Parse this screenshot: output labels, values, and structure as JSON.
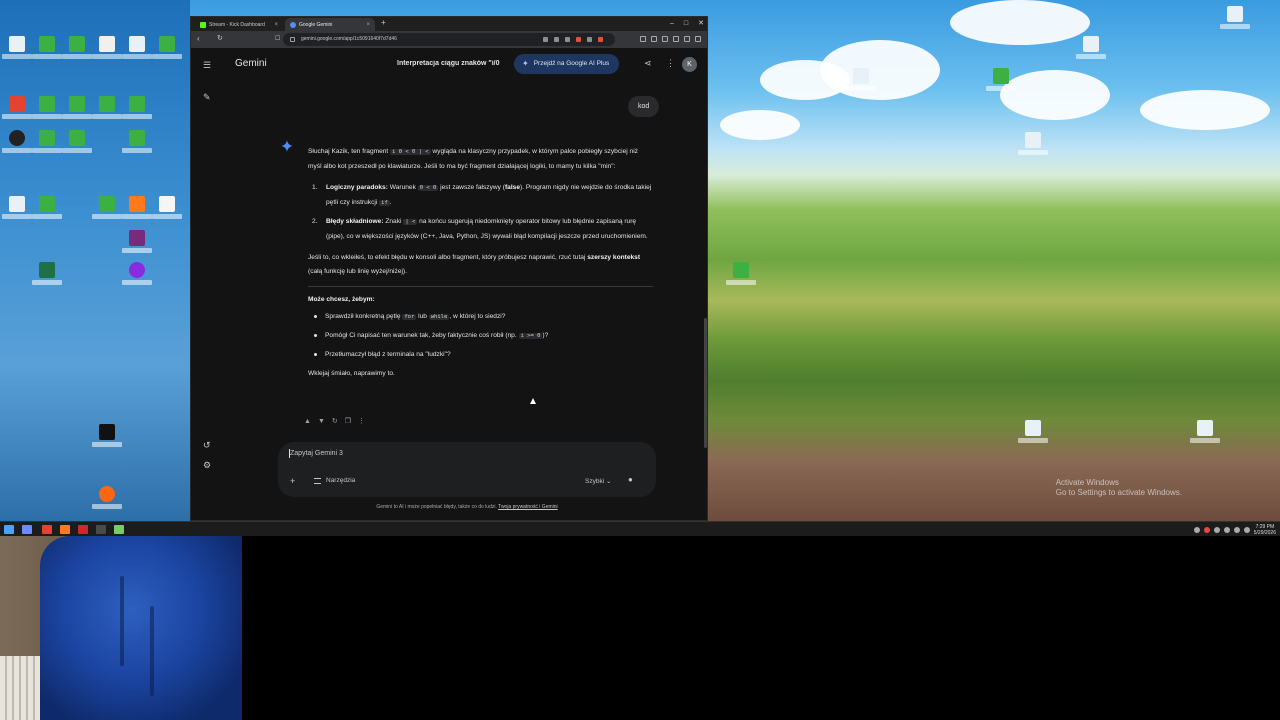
{
  "desktop": {
    "watermark_line1": "Activate Windows",
    "watermark_line2": "Go to Settings to activate Windows."
  },
  "taskbar": {
    "time": "7:29 PM",
    "date": "5/29/2026"
  },
  "browser": {
    "tabs": [
      {
        "label": "Stream - Kick Dashboard",
        "active": false
      },
      {
        "label": "Google Gemini",
        "active": true
      }
    ],
    "new_tab": "+",
    "url": "gemini.google.com/app/1c5091640f7d7d46",
    "window_controls": [
      "–",
      "□",
      "✕"
    ]
  },
  "gemini": {
    "app_name": "Gemini",
    "conversation_title": "Interpretacja ciągu znaków \"i/0",
    "upgrade_label": "Przejdź na Google AI Plus",
    "avatar_letter": "K",
    "user_message": "kod",
    "answer": {
      "p1_a": "Słuchaj Kazik, ten fragment ",
      "p1_code": "i 0 < 0 | <",
      "p1_b": " wygląda na klasyczny przypadek, w którym palce pobiegły szybciej niż myśl albo kot przeszedł po klawiaturze. Jeśli to ma być fragment działającej logiki, to mamy tu kilka \"min\":",
      "list1": [
        {
          "num": "1.",
          "title": "Logiczny paradoks:",
          "a": " Warunek ",
          "code": "0 < 0",
          "b": " jest zawsze fałszywy (",
          "bold": "false",
          "c": "). Program nigdy nie wejdzie do środka takiej pętli czy instrukcji ",
          "code2": "if",
          "d": "."
        },
        {
          "num": "2.",
          "title": "Błędy składniowe:",
          "a": " Znaki ",
          "code": "| <",
          "b": " na końcu sugerują niedomknięty operator bitowy lub błędnie zapisaną rurę (pipe), co w większości języków (C++, Java, Python, JS) wywali błąd kompilacji jeszcze przed uruchomieniem."
        }
      ],
      "p2_a": "Jeśli to, co wkleiłeś, to efekt błędu w konsoli albo fragment, który próbujesz naprawić, rzuć tutaj ",
      "p2_bold": "szerszy kontekst",
      "p2_b": " (całą funkcję lub linię wyżej/niżej).",
      "p3_bold": "Może chcesz, żebym:",
      "list2": [
        {
          "a": "Sprawdził konkretną pętlę ",
          "code": "for",
          "b": " lub ",
          "code2": "while",
          "c": ", w której to siedzi?"
        },
        {
          "a": "Pomógł Ci napisać ten warunek tak, żeby faktycznie coś robił (np. ",
          "code": "i >= 0",
          "b": ")?"
        },
        {
          "a": "Przetłumaczył błąd z terminala na \"ludzki\"?"
        }
      ],
      "p4": "Wklejaj śmiało, naprawimy to."
    },
    "input_placeholder": "Zapytaj Gemini 3",
    "tools_label": "Narzędzia",
    "model_label": "Szybki",
    "disclaimer_a": "Gemini to AI i może popełniać błędy, także co do ludzi. ",
    "disclaimer_link": "Twoja prywatność i Gemini"
  },
  "icons": {
    "menu": "☰",
    "new_chat": "✎",
    "share": "⋖",
    "more": "⋮",
    "plus": "+",
    "mic": "🎙",
    "chevron_down": "⌄",
    "thumb_up": "👍",
    "thumb_down": "👎",
    "regenerate": "↻",
    "copy": "❐",
    "more_h": "⋮",
    "history": "↺",
    "settings": "⚙"
  }
}
